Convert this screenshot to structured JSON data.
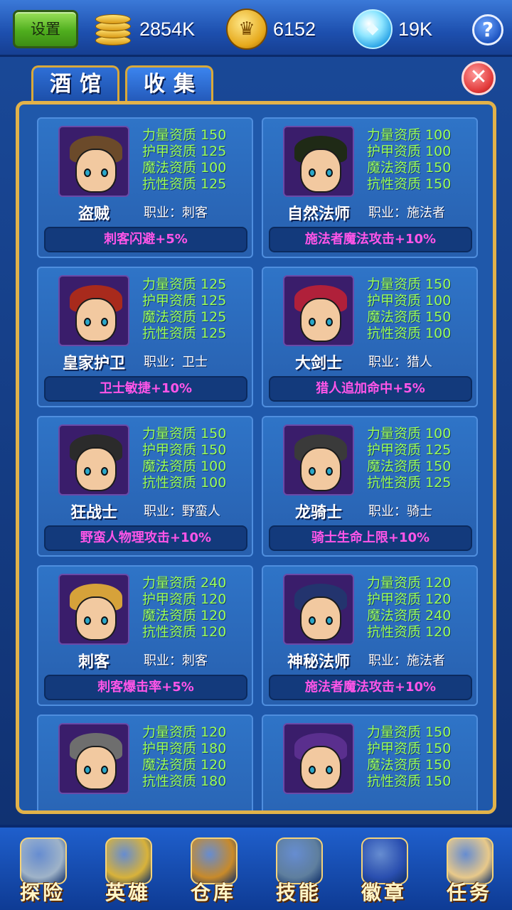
{
  "header": {
    "settings_label": "设置",
    "gold": "2854K",
    "crown_coins": "6152",
    "gems": "19K",
    "help_label": "?"
  },
  "tabs": [
    {
      "label": "酒馆"
    },
    {
      "label": "收集"
    }
  ],
  "close_label": "✕",
  "heroes": [
    {
      "name": "盗贼",
      "job": "职业：刺客",
      "bonus": "刺客闪避+5%",
      "stats": [
        "力量资质 150",
        "护甲资质 125",
        "魔法资质 100",
        "抗性资质 125"
      ],
      "hair": "#6b4a2a"
    },
    {
      "name": "自然法师",
      "job": "职业：施法者",
      "bonus": "施法者魔法攻击+10%",
      "stats": [
        "力量资质 100",
        "护甲资质 100",
        "魔法资质 150",
        "抗性资质 150"
      ],
      "hair": "#1f2a16"
    },
    {
      "name": "皇家护卫",
      "job": "职业：卫士",
      "bonus": "卫士敏捷+10%",
      "stats": [
        "力量资质 125",
        "护甲资质 125",
        "魔法资质 125",
        "抗性资质 125"
      ],
      "hair": "#a82a1c"
    },
    {
      "name": "大剑士",
      "job": "职业：猎人",
      "bonus": "猎人追加命中+5%",
      "stats": [
        "力量资质 150",
        "护甲资质 100",
        "魔法资质 150",
        "抗性资质 100"
      ],
      "hair": "#b0203a"
    },
    {
      "name": "狂战士",
      "job": "职业：野蛮人",
      "bonus": "野蛮人物理攻击+10%",
      "stats": [
        "力量资质 150",
        "护甲资质 150",
        "魔法资质 100",
        "抗性资质 100"
      ],
      "hair": "#2b2b2b"
    },
    {
      "name": "龙骑士",
      "job": "职业：骑士",
      "bonus": "骑士生命上限+10%",
      "stats": [
        "力量资质 100",
        "护甲资质 125",
        "魔法资质 150",
        "抗性资质 125"
      ],
      "hair": "#3a3a3a"
    },
    {
      "name": "刺客",
      "job": "职业：刺客",
      "bonus": "刺客爆击率+5%",
      "stats": [
        "力量资质 240",
        "护甲资质 120",
        "魔法资质 120",
        "抗性资质 120"
      ],
      "hair": "#d6a23a"
    },
    {
      "name": "神秘法师",
      "job": "职业：施法者",
      "bonus": "施法者魔法攻击+10%",
      "stats": [
        "力量资质 120",
        "护甲资质 120",
        "魔法资质 240",
        "抗性资质 120"
      ],
      "hair": "#23346e"
    },
    {
      "name": "",
      "job": "",
      "bonus": "",
      "stats": [
        "力量资质 120",
        "护甲资质 180",
        "魔法资质 120",
        "抗性资质 180"
      ],
      "hair": "#6e6e6e"
    },
    {
      "name": "",
      "job": "",
      "bonus": "",
      "stats": [
        "力量资质 150",
        "护甲资质 150",
        "魔法资质 150",
        "抗性资质 150"
      ],
      "hair": "#5a2f8e"
    }
  ],
  "bottom_nav": [
    {
      "label": "探险",
      "icon": "sword-shield-icon",
      "color": "#9fb3c8"
    },
    {
      "label": "英雄",
      "icon": "helmet-icon",
      "color": "#d8b23a"
    },
    {
      "label": "仓库",
      "icon": "treasure-chest-icon",
      "color": "#c88a2a"
    },
    {
      "label": "技能",
      "icon": "spellbook-icon",
      "color": "#5f7f9e"
    },
    {
      "label": "徽章",
      "icon": "fleur-de-lis-badge-icon",
      "color": "#2a4fb0"
    },
    {
      "label": "任务",
      "icon": "scroll-quill-icon",
      "color": "#e8c98a"
    }
  ]
}
